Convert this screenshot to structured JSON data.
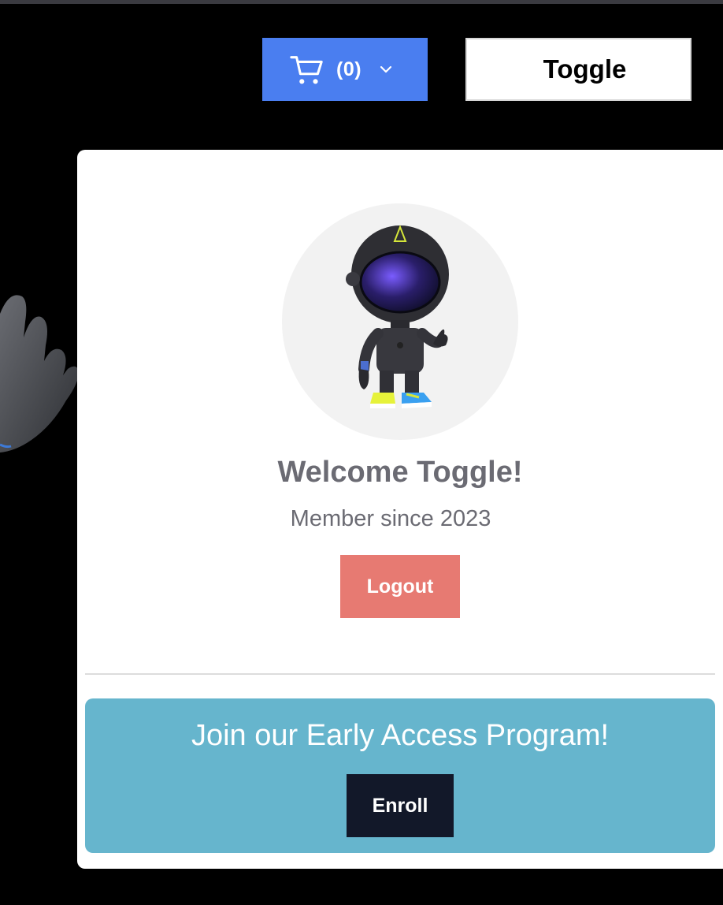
{
  "header": {
    "cart": {
      "icon": "shopping-cart-icon",
      "count_label": "(0)",
      "chevron": "chevron-down-icon",
      "color": "#4a7ef0"
    },
    "toggle_label": "Toggle"
  },
  "profile": {
    "avatar": "astronaut-avatar",
    "welcome": "Welcome Toggle!",
    "member_since": "Member since 2023",
    "logout_label": "Logout",
    "logout_color": "#e77a72"
  },
  "early_access": {
    "text": "Join our Early Access Program!",
    "enroll_label": "Enroll",
    "background": "#66b5cd",
    "button_color": "#121829"
  }
}
